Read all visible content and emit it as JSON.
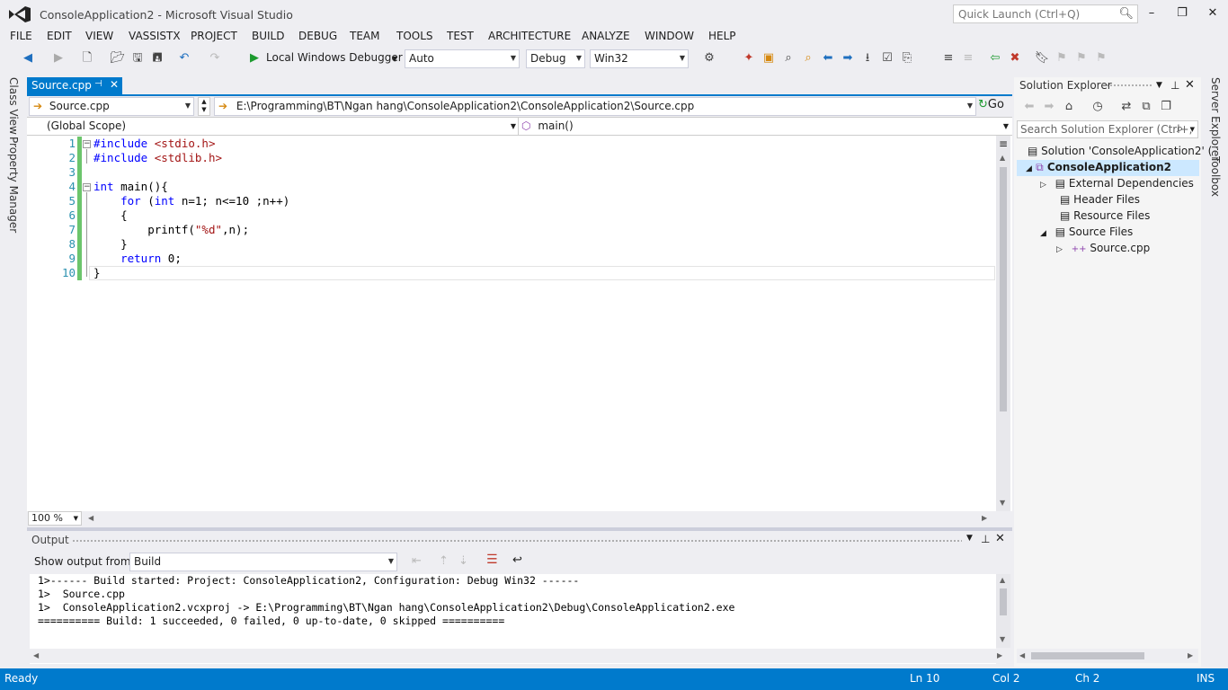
{
  "window": {
    "title": "ConsoleApplication2 - Microsoft Visual Studio",
    "quick_launch_placeholder": "Quick Launch (Ctrl+Q)"
  },
  "menu": [
    "FILE",
    "EDIT",
    "VIEW",
    "VASSISTX",
    "PROJECT",
    "BUILD",
    "DEBUG",
    "TEAM",
    "TOOLS",
    "TEST",
    "ARCHITECTURE",
    "ANALYZE",
    "WINDOW",
    "HELP"
  ],
  "toolbar": {
    "debugger_label": "Local Windows Debugger",
    "solution_config_auto": "Auto",
    "configuration": "Debug",
    "platform": "Win32"
  },
  "side_tabs": {
    "class_view": "Class View",
    "property_manager": "Property Manager",
    "server_explorer": "Server Explorer",
    "toolbox": "Toolbox"
  },
  "document": {
    "tab_label": "Source.cpp",
    "file_combo": "Source.cpp",
    "path": "E:\\Programming\\BT\\Ngan hang\\ConsoleApplication2\\ConsoleApplication2\\Source.cpp",
    "go_label": "Go",
    "scope": "(Global Scope)",
    "member": "main()",
    "zoom": "100 %"
  },
  "code": {
    "line_numbers": [
      "1",
      "2",
      "3",
      "4",
      "5",
      "6",
      "7",
      "8",
      "9",
      "10"
    ],
    "lines": [
      {
        "segments": [
          {
            "t": "#include ",
            "c": "pp"
          },
          {
            "t": "<stdio.h>",
            "c": "inc"
          }
        ]
      },
      {
        "segments": [
          {
            "t": "#include ",
            "c": "pp"
          },
          {
            "t": "<stdlib.h>",
            "c": "inc"
          }
        ]
      },
      {
        "segments": []
      },
      {
        "segments": [
          {
            "t": "int",
            "c": "kw"
          },
          {
            "t": " main(){",
            "c": ""
          }
        ]
      },
      {
        "segments": [
          {
            "t": "    ",
            "c": ""
          },
          {
            "t": "for",
            "c": "kw"
          },
          {
            "t": " (",
            "c": ""
          },
          {
            "t": "int",
            "c": "kw"
          },
          {
            "t": " n=1; n<=10 ;n++)",
            "c": ""
          }
        ]
      },
      {
        "segments": [
          {
            "t": "    {",
            "c": ""
          }
        ]
      },
      {
        "segments": [
          {
            "t": "        printf(",
            "c": ""
          },
          {
            "t": "\"%d\"",
            "c": "str"
          },
          {
            "t": ",n);",
            "c": ""
          }
        ]
      },
      {
        "segments": [
          {
            "t": "    }",
            "c": ""
          }
        ]
      },
      {
        "segments": [
          {
            "t": "    ",
            "c": ""
          },
          {
            "t": "return",
            "c": "kw"
          },
          {
            "t": " 0;",
            "c": ""
          }
        ]
      },
      {
        "segments": [
          {
            "t": "}",
            "c": ""
          }
        ]
      }
    ]
  },
  "output": {
    "title": "Output",
    "show_from_label": "Show output from:",
    "show_from_value": "Build",
    "lines": [
      "1>------ Build started: Project: ConsoleApplication2, Configuration: Debug Win32 ------",
      "1>  Source.cpp",
      "1>  ConsoleApplication2.vcxproj -> E:\\Programming\\BT\\Ngan hang\\ConsoleApplication2\\Debug\\ConsoleApplication2.exe",
      "========== Build: 1 succeeded, 0 failed, 0 up-to-date, 0 skipped =========="
    ]
  },
  "solution_explorer": {
    "title": "Solution Explorer",
    "search_placeholder": "Search Solution Explorer (Ctrl+;",
    "solution": "Solution 'ConsoleApplication2' (",
    "project": "ConsoleApplication2",
    "external_dependencies": "External Dependencies",
    "header_files": "Header Files",
    "resource_files": "Resource Files",
    "source_files": "Source Files",
    "source_cpp": "Source.cpp"
  },
  "status": {
    "state": "Ready",
    "line": "Ln 10",
    "col": "Col 2",
    "ch": "Ch 2",
    "mode": "INS"
  },
  "colors": {
    "accent": "#007acc",
    "keyword": "#0000ff",
    "string": "#a31515",
    "line_number": "#2b91af",
    "change_bar": "#6cc56c"
  }
}
